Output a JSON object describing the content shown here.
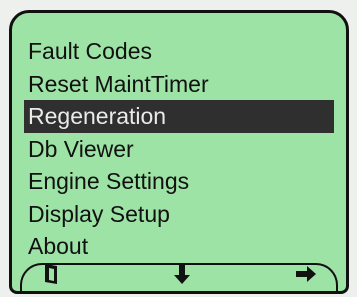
{
  "menu": {
    "items": [
      {
        "label": "Fault Codes"
      },
      {
        "label": "Reset MaintTimer"
      },
      {
        "label": "Regeneration"
      },
      {
        "label": "Db Viewer"
      },
      {
        "label": "Engine Settings"
      },
      {
        "label": "Display Setup"
      },
      {
        "label": "About"
      }
    ],
    "selected_label": "Regeneration"
  },
  "softkeys": {
    "left_icon": "door-exit-icon",
    "middle_icon": "arrow-down-icon",
    "right_icon": "arrow-right-icon"
  },
  "colors": {
    "screen_background": "#9ee3a6",
    "selection_background": "#2f2f2f",
    "text": "#111111"
  }
}
